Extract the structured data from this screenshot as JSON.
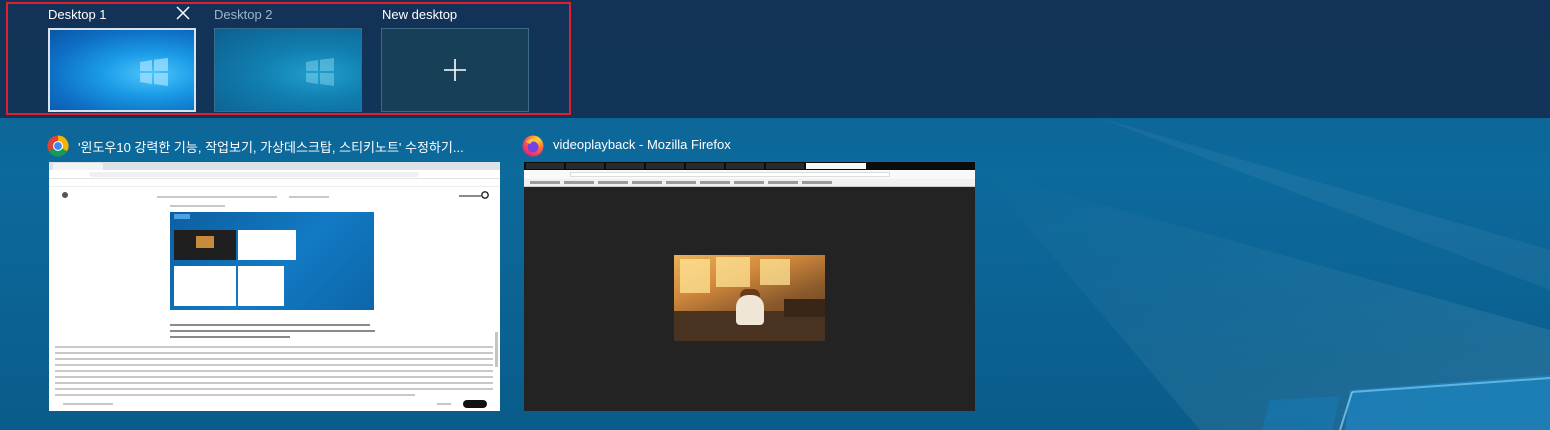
{
  "virtual_desktops": {
    "desktops": [
      {
        "label": "Desktop 1",
        "selected": true
      },
      {
        "label": "Desktop 2",
        "selected": false
      }
    ],
    "new_desktop_label": "New desktop",
    "close_icon": "close-icon",
    "add_icon": "plus-icon"
  },
  "windows": [
    {
      "app": "chrome",
      "icon": "chrome-icon",
      "title": "'윈도우10 강력한 기능, 작업보기, 가상데스크탑, 스티키노트' 수정하기..."
    },
    {
      "app": "firefox",
      "icon": "firefox-icon",
      "title": "videoplayback - Mozilla Firefox"
    }
  ],
  "colors": {
    "focus_outline": "#e0202a",
    "strip_background": "#123052",
    "wallpaper": "#0c6a9c"
  }
}
